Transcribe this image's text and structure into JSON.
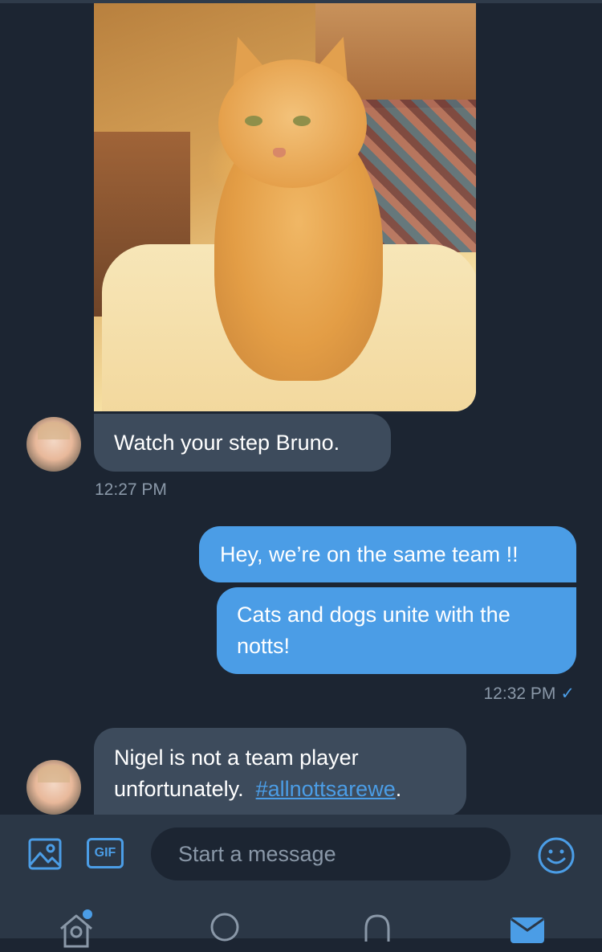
{
  "colors": {
    "background": "#1c2532",
    "incoming_bubble": "#3d4b5c",
    "outgoing_bubble": "#4b9de6",
    "timestamp": "#8a98a8",
    "accent": "#4b9de6"
  },
  "messages": [
    {
      "type": "image",
      "direction": "incoming",
      "icon": "cat-photo"
    },
    {
      "type": "text",
      "direction": "incoming",
      "text": "Watch your step Bruno.",
      "timestamp": "12:27 PM"
    },
    {
      "type": "text",
      "direction": "outgoing",
      "text": "Hey, we’re on the same team !!"
    },
    {
      "type": "text",
      "direction": "outgoing",
      "text": "Cats and dogs unite with the notts!",
      "timestamp": "12:32 PM",
      "read_mark": "✓"
    },
    {
      "type": "text",
      "direction": "incoming",
      "text_line1": "Nigel is not a team player",
      "text_line2_prefix": "unfortunately.  ",
      "hashtag": "#allnottsarewe",
      "text_line2_suffix": "."
    }
  ],
  "composer": {
    "image_icon": "image-icon",
    "gif_label": "GIF",
    "placeholder": "Start a message",
    "emoji_icon": "smiley-icon"
  },
  "tabbar": {
    "items": [
      {
        "icon": "home-icon",
        "has_notification_dot": true
      },
      {
        "icon": "search-icon"
      },
      {
        "icon": "bell-icon"
      },
      {
        "icon": "mail-icon",
        "active": true
      }
    ]
  }
}
